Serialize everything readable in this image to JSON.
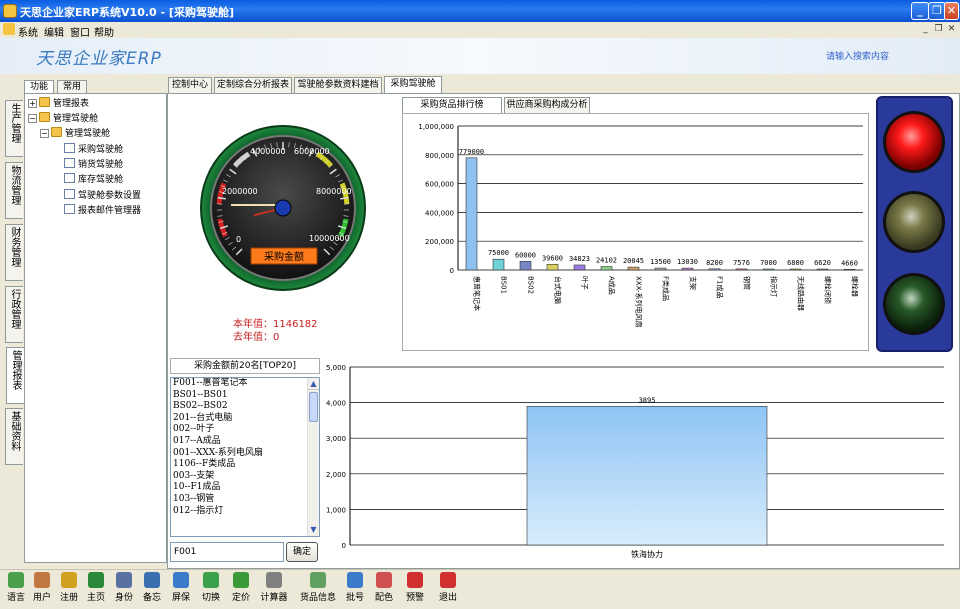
{
  "window": {
    "title": "天思企业家ERP系统V10.0 - [采购驾驶舱]"
  },
  "menu": [
    "系统",
    "编辑",
    "窗口",
    "帮助"
  ],
  "banner": {
    "logo": "天思企业家ERP",
    "search_placeholder": "请输入搜索内容"
  },
  "left": {
    "top_tabs": [
      "功能",
      "常用"
    ],
    "side_tabs": [
      "生产管理",
      "物流管理",
      "财务管理",
      "行政管理",
      "管理报表",
      "基础资料"
    ],
    "tree": [
      "管理报表",
      "管理驾驶舱",
      "管理驾驶舱",
      "采购驾驶舱",
      "销货驾驶舱",
      "库存驾驶舱",
      "驾驶舱参数设置",
      "报表邮件管理器"
    ]
  },
  "main_tabs": [
    "控制中心",
    "定制综合分析报表",
    "驾驶舱参数资料建档",
    "采购驾驶舱"
  ],
  "gauge": {
    "ticks": [
      "0",
      "2000000",
      "4000000",
      "6000000",
      "8000000",
      "10000000"
    ],
    "label": "采购金额",
    "value": 1146182,
    "max": 10000000,
    "this_year_label": "本年值：",
    "this_year_value": "1146182",
    "last_year_label": "去年值：",
    "last_year_value": "0"
  },
  "chart_tabs": [
    "采购货品排行榜[TOP20]",
    "供应商采购构成分析"
  ],
  "chart_data": [
    {
      "type": "bar",
      "categories": [
        "惠普笔记本",
        "BS01",
        "BS02",
        "台式电脑",
        "叶子",
        "A成品",
        "XXX-系列电风扇",
        "F类成品",
        "支架",
        "F1成品",
        "钢管",
        "指示灯",
        "无线路由器",
        "螺栓闭锁",
        "螺栓器"
      ],
      "values": [
        779000,
        75000,
        60000,
        39600,
        34823,
        24102,
        20045,
        13500,
        13030,
        8200,
        7576,
        7000,
        6800,
        6620,
        4660
      ],
      "value_labels": [
        "779000",
        "75000",
        "60000",
        "39600",
        "34823",
        "24102",
        "20045",
        "13500",
        "13030",
        "8200",
        "7576",
        "7000",
        "6800",
        "6620",
        "4660"
      ],
      "bar_colors": [
        "#8ec0f0",
        "#6fd0d8",
        "#7a86c8",
        "#d9d060",
        "#9a7ae0",
        "#8ed08a",
        "#d0a070",
        "#a0b0a0",
        "#c080d0",
        "#90b0e0",
        "#e08080",
        "#7acfcf",
        "#c8c060",
        "#b09070",
        "#9090d0"
      ],
      "ylim": [
        0,
        1000000
      ],
      "yticks": [
        "0",
        "200,000",
        "400,000",
        "600,000",
        "800,000",
        "1,000,000"
      ]
    },
    {
      "type": "bar",
      "categories": [
        "铁海协力"
      ],
      "values": [
        3895
      ],
      "value_labels": [
        "3895"
      ],
      "ylim": [
        0,
        5000
      ],
      "yticks": [
        "0",
        "1,000",
        "2,000",
        "3,000",
        "4,000",
        "5,000"
      ]
    }
  ],
  "list": {
    "title": "采购金额前20名[TOP20]",
    "items": [
      "F001--惠普笔记本",
      "BS01--BS01",
      "BS02--BS02",
      "201--台式电脑",
      "002--叶子",
      "017--A成品",
      "001--XXX-系列电风扇",
      "1106--F类成品",
      "003--支架",
      "10--F1成品",
      "103--钢管",
      "012--指示灯"
    ],
    "input_value": "F001",
    "ok_label": "确定"
  },
  "toolbar": [
    {
      "label": "语言",
      "icon": "language-icon",
      "color": "#4aa04a"
    },
    {
      "label": "用户",
      "icon": "users-icon",
      "color": "#c07840"
    },
    {
      "label": "注册",
      "icon": "key-icon",
      "color": "#d0a020"
    },
    {
      "label": "主页",
      "icon": "globe-icon",
      "color": "#2a8a3a"
    },
    {
      "label": "身份",
      "icon": "id-card-icon",
      "color": "#5a70a0"
    },
    {
      "label": "备忘",
      "icon": "memo-icon",
      "color": "#3a70b0"
    },
    {
      "label": "屏保",
      "icon": "monitor-icon",
      "color": "#3a7ac8"
    },
    {
      "label": "切换",
      "icon": "switch-icon",
      "color": "#3aa04a"
    },
    {
      "label": "定价",
      "icon": "price-icon",
      "color": "#3a9a3a"
    },
    {
      "label": "计算器",
      "icon": "calculator-icon",
      "color": "#808080"
    },
    {
      "label": "货品信息",
      "icon": "goods-icon",
      "color": "#60a060"
    },
    {
      "label": "批号",
      "icon": "batch-icon",
      "color": "#3a7ac8"
    },
    {
      "label": "配色",
      "icon": "palette-icon",
      "color": "#d05050"
    },
    {
      "label": "预警",
      "icon": "warning-icon",
      "color": "#d03030"
    },
    {
      "label": "退出",
      "icon": "exit-icon",
      "color": "#d03030"
    }
  ]
}
